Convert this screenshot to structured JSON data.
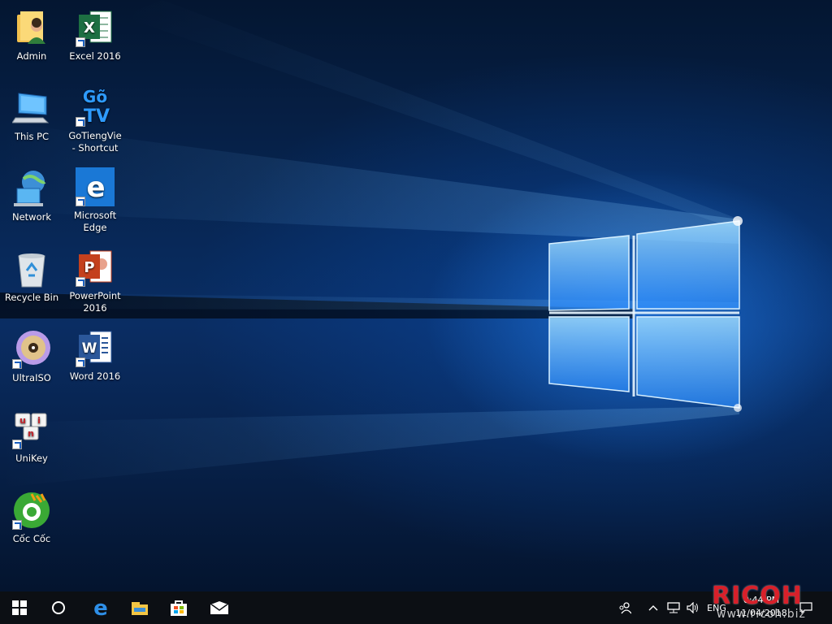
{
  "desktop": {
    "icons": [
      {
        "label": "Admin",
        "icon": "user-folder-icon"
      },
      {
        "label": "Excel 2016",
        "icon": "excel-icon"
      },
      {
        "label": "This PC",
        "icon": "computer-icon"
      },
      {
        "label": "GoTiengVie - Shortcut",
        "icon": "gotiengviet-icon",
        "logo_text": "Gõ TV"
      },
      {
        "label": "Network",
        "icon": "network-icon"
      },
      {
        "label": "Microsoft Edge",
        "icon": "edge-icon"
      },
      {
        "label": "Recycle Bin",
        "icon": "recycle-bin-icon"
      },
      {
        "label": "PowerPoint 2016",
        "icon": "powerpoint-icon"
      },
      {
        "label": "UltraISO",
        "icon": "disc-icon"
      },
      {
        "label": "Word 2016",
        "icon": "word-icon"
      },
      {
        "label": "UniKey",
        "icon": "unikey-icon"
      },
      {
        "label": "Cốc Cốc",
        "icon": "coccoc-icon"
      }
    ]
  },
  "taskbar": {
    "pinned": [
      {
        "name": "start",
        "icon": "windows-logo-icon"
      },
      {
        "name": "search",
        "icon": "search-circle-icon"
      },
      {
        "name": "edge",
        "icon": "edge-icon"
      },
      {
        "name": "file-explorer",
        "icon": "folder-icon"
      },
      {
        "name": "store",
        "icon": "store-bag-icon"
      },
      {
        "name": "mail",
        "icon": "mail-icon"
      }
    ],
    "tray": {
      "language": "ENG",
      "time": "0:44 PM",
      "date": "11/04/2018"
    }
  },
  "watermark": {
    "brand": "RICOH",
    "site": "www.ricoh.biz"
  },
  "colors": {
    "taskbar": "#0c0f14",
    "wallpaper_accent": "#2a8cff"
  }
}
